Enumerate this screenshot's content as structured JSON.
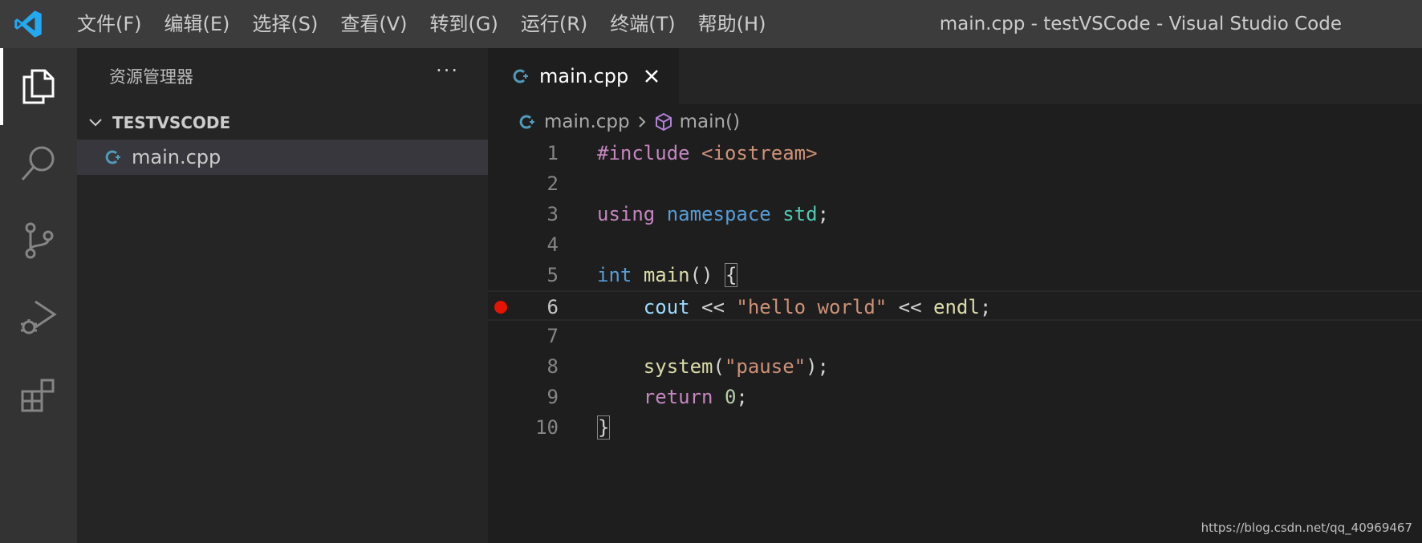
{
  "titlebar": {
    "menu": [
      {
        "label": "文件(F)"
      },
      {
        "label": "编辑(E)"
      },
      {
        "label": "选择(S)"
      },
      {
        "label": "查看(V)"
      },
      {
        "label": "转到(G)"
      },
      {
        "label": "运行(R)"
      },
      {
        "label": "终端(T)"
      },
      {
        "label": "帮助(H)"
      }
    ],
    "window_title": "main.cpp - testVSCode - Visual Studio Code"
  },
  "activitybar": {
    "items": [
      {
        "icon": "files-icon",
        "active": true
      },
      {
        "icon": "search-icon",
        "active": false
      },
      {
        "icon": "source-control-icon",
        "active": false
      },
      {
        "icon": "run-debug-icon",
        "active": false
      },
      {
        "icon": "extensions-icon",
        "active": false
      }
    ]
  },
  "sidebar": {
    "title": "资源管理器",
    "more": "···",
    "folder": "TESTVSCODE",
    "files": [
      {
        "name": "main.cpp"
      }
    ]
  },
  "editor": {
    "tab": {
      "label": "main.cpp"
    },
    "breadcrumbs": {
      "file": "main.cpp",
      "symbol": "main()"
    },
    "line_numbers": [
      "1",
      "2",
      "3",
      "4",
      "5",
      "6",
      "7",
      "8",
      "9",
      "10"
    ],
    "code": {
      "l1": {
        "a": "#include",
        "b": " ",
        "c": "<iostream>"
      },
      "l3": {
        "a": "using",
        "b": " ",
        "c": "namespace",
        "d": " ",
        "e": "std",
        "f": ";"
      },
      "l5": {
        "a": "int",
        "b": " ",
        "c": "main",
        "d": "() ",
        "e": "{"
      },
      "l6": {
        "a": "    ",
        "b": "cout",
        "c": " << ",
        "d": "\"hello world\"",
        "e": " << ",
        "f": "endl",
        "g": ";"
      },
      "l8": {
        "a": "    ",
        "b": "system",
        "c": "(",
        "d": "\"pause\"",
        "e": ");"
      },
      "l9": {
        "a": "    ",
        "b": "return",
        "c": " ",
        "d": "0",
        "e": ";"
      },
      "l10": {
        "a": "}"
      }
    },
    "breakpoint_line": "6",
    "current_line": "6"
  },
  "colors": {
    "accent_blue": "#569cd6",
    "breakpoint_red": "#e51400",
    "cpp_icon": "#519aba"
  },
  "watermark": "https://blog.csdn.net/qq_40969467"
}
